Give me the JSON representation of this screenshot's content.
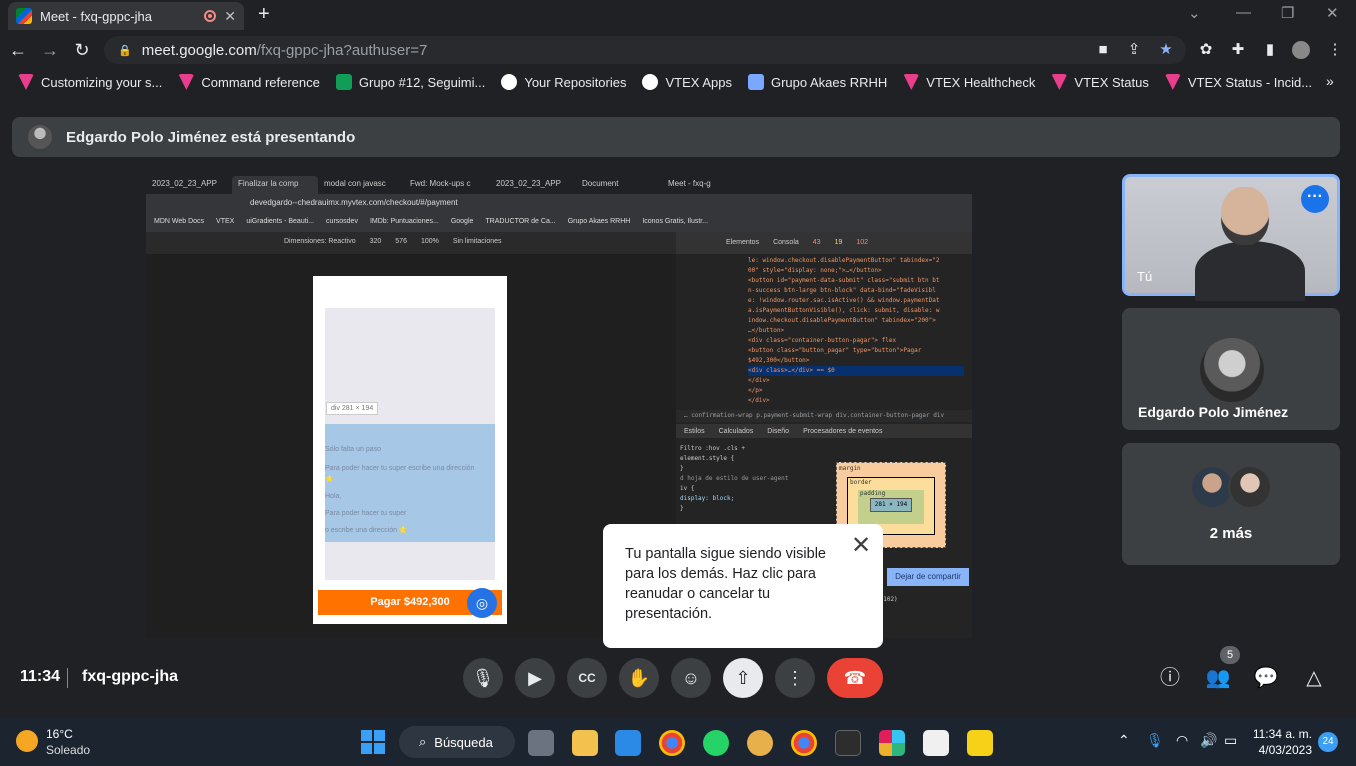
{
  "browser": {
    "tab_title": "Meet - fxq-gppc-jha",
    "url_host": "meet.google.com",
    "url_path": "/fxq-gppc-jha?authuser=7"
  },
  "bookmarks": [
    {
      "label": "Customizing your s...",
      "color": "#e83e8c"
    },
    {
      "label": "Command reference",
      "color": "#e83e8c"
    },
    {
      "label": "Grupo #12, Seguimi...",
      "color": "#0f9d58"
    },
    {
      "label": "Your Repositories",
      "color": "#ffffff"
    },
    {
      "label": "VTEX Apps",
      "color": "#ffffff"
    },
    {
      "label": "Grupo Akaes RRHH",
      "color": "#7aa7ff"
    },
    {
      "label": "VTEX Healthcheck",
      "color": "#e83e8c"
    },
    {
      "label": "VTEX Status",
      "color": "#e83e8c"
    },
    {
      "label": "VTEX Status - Incid...",
      "color": "#e83e8c"
    }
  ],
  "presenter_bar": {
    "text": "Edgardo Polo Jiménez está presentando"
  },
  "shared": {
    "tabs": [
      "2023_02_23_APP",
      "Finalizar la comp",
      "modal con javasc",
      "Fwd: Mock-ups c",
      "2023_02_23_APP",
      "Document",
      "Meet - fxq-g"
    ],
    "url": "devedgardo--chedrauimx.myvtex.com/checkout/#/payment",
    "bookmarks": [
      "MDN Web Docs",
      "VTEX",
      "uiGradients - Beauti...",
      "cursosdev",
      "IMDb: Puntuaciones...",
      "Google",
      "TRADUCTOR de Ca...",
      "Grupo Akaes RRHH",
      "Iconos Gratis, Ilustr..."
    ],
    "device_bar": [
      "Dimensiones: Reactivo",
      "320",
      "576",
      "100%",
      "Sin limitaciones"
    ],
    "tooltip": "div  281 × 194",
    "phone_lines": [
      "Sólo falta un paso",
      "Para poder hacer tu super escribe una dirección",
      "⭐",
      "Hola,",
      "Para poder hacer tu super",
      "o escribe una dirección ⭐"
    ],
    "pay_button": "Pagar $492,300",
    "devtools_tabs": [
      "Elementos",
      "Consola",
      "43",
      "19",
      "102"
    ],
    "code_lines": [
      "le: window.checkout.disablePaymentButton\" tabindex=\"2",
      "00\" style=\"display: none;\">…</button>",
      "<button id=\"payment-data-submit\" class=\"submit btn bt",
      "n-success btn-large btn-block\" data-bind=\"fadeVisibl",
      "e: !window.router.sac.isActive() && window.paymentDat",
      "a.isPaymentButtonVisible(), click: submit, disable: w",
      "indow.checkout.disablePaymentButton\" tabindex=\"200\">",
      "…</button>",
      "<div class=\"container-button-pagar\"> flex",
      "<button class=\"button_pagar\" type=\"button\">Pagar",
      "$492,300</button>",
      "<div class>…</div> == $0",
      "</div>",
      "</p>",
      "</div>"
    ],
    "crumbs": "… confirmation-wrap   p.payment-submit-wrap   div.container-button-pagar   div",
    "style_tabs": [
      "Estilos",
      "Calculados",
      "Diseño",
      "Procesadores de eventos"
    ],
    "style_lines": [
      "Filtro            :hov  .cls  +",
      "element.style {",
      "}",
      "d    hoja de estilo de user-agent",
      "iv {",
      "  display: block;",
      "}"
    ],
    "box_size": "281 × 194",
    "stop_share": "Dejar de compartir",
    "box_labels": {
      "margin": "margin",
      "border": "border",
      "padding": "padding"
    },
    "code_tail": ", 102)"
  },
  "popup": {
    "text": "Tu pantalla sigue siendo visible para los demás. Haz clic para reanudar o cancelar tu presentación."
  },
  "tiles": {
    "self_label": "Tú",
    "presenter_name": "Edgardo Polo Jiménez",
    "more_label": "2 más"
  },
  "meeting": {
    "time": "11:34",
    "code": "fxq-gppc-jha",
    "people_count": "5"
  },
  "taskbar": {
    "temp": "16°C",
    "condition": "Soleado",
    "search": "Búsqueda",
    "time": "11:34 a. m.",
    "date": "4/03/2023",
    "notifications": "24"
  }
}
